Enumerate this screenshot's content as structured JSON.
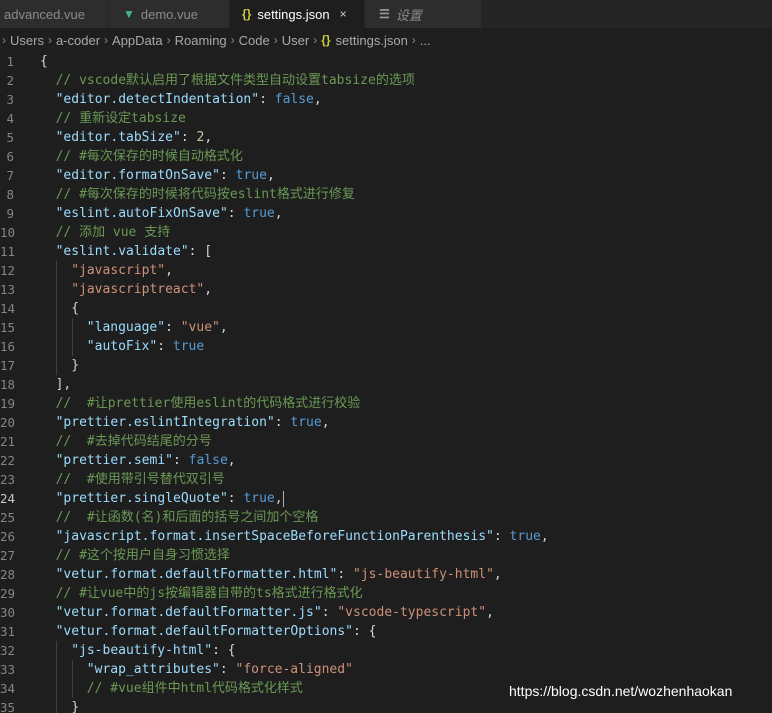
{
  "tabs": [
    {
      "label": "advanced.vue",
      "icon": "",
      "active": false
    },
    {
      "label": "demo.vue",
      "icon": "vue-icon",
      "active": false
    },
    {
      "label": "settings.json",
      "icon": "json-braces-icon",
      "active": true,
      "close": "×"
    },
    {
      "label": "设置",
      "icon": "settings-list-icon",
      "active": false
    }
  ],
  "breadcrumb": [
    "Users",
    "a-coder",
    "AppData",
    "Roaming",
    "Code",
    "User",
    "settings.json",
    "..."
  ],
  "lines": [
    {
      "n": "1",
      "i": 0,
      "t": [
        [
          "p",
          "{"
        ]
      ]
    },
    {
      "n": "2",
      "i": 1,
      "t": [
        [
          "c",
          "// vscode默认启用了根据文件类型自动设置tabsize的选项"
        ]
      ]
    },
    {
      "n": "3",
      "i": 1,
      "t": [
        [
          "k",
          "\"editor.detectIndentation\""
        ],
        [
          "p",
          ": "
        ],
        [
          "b",
          "false"
        ],
        [
          "p",
          ","
        ]
      ]
    },
    {
      "n": "4",
      "i": 1,
      "t": [
        [
          "c",
          "// 重新设定tabsize"
        ]
      ]
    },
    {
      "n": "5",
      "i": 1,
      "t": [
        [
          "k",
          "\"editor.tabSize\""
        ],
        [
          "p",
          ": "
        ],
        [
          "n",
          "2"
        ],
        [
          "p",
          ","
        ]
      ]
    },
    {
      "n": "6",
      "i": 1,
      "t": [
        [
          "c",
          "// #每次保存的时候自动格式化"
        ]
      ]
    },
    {
      "n": "7",
      "i": 1,
      "t": [
        [
          "k",
          "\"editor.formatOnSave\""
        ],
        [
          "p",
          ": "
        ],
        [
          "b",
          "true"
        ],
        [
          "p",
          ","
        ]
      ]
    },
    {
      "n": "8",
      "i": 1,
      "t": [
        [
          "c",
          "// #每次保存的时候将代码按eslint格式进行修复"
        ]
      ]
    },
    {
      "n": "9",
      "i": 1,
      "t": [
        [
          "k",
          "\"eslint.autoFixOnSave\""
        ],
        [
          "p",
          ": "
        ],
        [
          "b",
          "true"
        ],
        [
          "p",
          ","
        ]
      ]
    },
    {
      "n": "10",
      "i": 1,
      "t": [
        [
          "c",
          "// 添加 vue 支持"
        ]
      ]
    },
    {
      "n": "11",
      "i": 1,
      "t": [
        [
          "k",
          "\"eslint.validate\""
        ],
        [
          "p",
          ": ["
        ]
      ]
    },
    {
      "n": "12",
      "i": 2,
      "t": [
        [
          "s",
          "\"javascript\""
        ],
        [
          "p",
          ","
        ]
      ]
    },
    {
      "n": "13",
      "i": 2,
      "t": [
        [
          "s",
          "\"javascriptreact\""
        ],
        [
          "p",
          ","
        ]
      ]
    },
    {
      "n": "14",
      "i": 2,
      "t": [
        [
          "p",
          "{"
        ]
      ]
    },
    {
      "n": "15",
      "i": 3,
      "t": [
        [
          "k",
          "\"language\""
        ],
        [
          "p",
          ": "
        ],
        [
          "s",
          "\"vue\""
        ],
        [
          "p",
          ","
        ]
      ]
    },
    {
      "n": "16",
      "i": 3,
      "t": [
        [
          "k",
          "\"autoFix\""
        ],
        [
          "p",
          ": "
        ],
        [
          "b",
          "true"
        ]
      ]
    },
    {
      "n": "17",
      "i": 2,
      "t": [
        [
          "p",
          "}"
        ]
      ]
    },
    {
      "n": "18",
      "i": 1,
      "t": [
        [
          "p",
          "],"
        ]
      ]
    },
    {
      "n": "19",
      "i": 1,
      "t": [
        [
          "c",
          "//  #让prettier使用eslint的代码格式进行校验"
        ]
      ]
    },
    {
      "n": "20",
      "i": 1,
      "t": [
        [
          "k",
          "\"prettier.eslintIntegration\""
        ],
        [
          "p",
          ": "
        ],
        [
          "b",
          "true"
        ],
        [
          "p",
          ","
        ]
      ]
    },
    {
      "n": "21",
      "i": 1,
      "t": [
        [
          "c",
          "//  #去掉代码结尾的分号"
        ]
      ]
    },
    {
      "n": "22",
      "i": 1,
      "t": [
        [
          "k",
          "\"prettier.semi\""
        ],
        [
          "p",
          ": "
        ],
        [
          "b",
          "false"
        ],
        [
          "p",
          ","
        ]
      ]
    },
    {
      "n": "23",
      "i": 1,
      "t": [
        [
          "c",
          "//  #使用带引号替代双引号"
        ]
      ]
    },
    {
      "n": "24",
      "i": 1,
      "cur": true,
      "t": [
        [
          "k",
          "\"prettier.singleQuote\""
        ],
        [
          "p",
          ": "
        ],
        [
          "b",
          "true"
        ],
        [
          "p",
          ","
        ]
      ]
    },
    {
      "n": "25",
      "i": 1,
      "t": [
        [
          "c",
          "//  #让函数(名)和后面的括号之间加个空格"
        ]
      ]
    },
    {
      "n": "26",
      "i": 1,
      "t": [
        [
          "k",
          "\"javascript.format.insertSpaceBeforeFunctionParenthesis\""
        ],
        [
          "p",
          ": "
        ],
        [
          "b",
          "true"
        ],
        [
          "p",
          ","
        ]
      ]
    },
    {
      "n": "27",
      "i": 1,
      "t": [
        [
          "c",
          "// #这个按用户自身习惯选择"
        ]
      ]
    },
    {
      "n": "28",
      "i": 1,
      "t": [
        [
          "k",
          "\"vetur.format.defaultFormatter.html\""
        ],
        [
          "p",
          ": "
        ],
        [
          "s",
          "\"js-beautify-html\""
        ],
        [
          "p",
          ","
        ]
      ]
    },
    {
      "n": "29",
      "i": 1,
      "t": [
        [
          "c",
          "// #让vue中的js按编辑器自带的ts格式进行格式化"
        ]
      ]
    },
    {
      "n": "30",
      "i": 1,
      "t": [
        [
          "k",
          "\"vetur.format.defaultFormatter.js\""
        ],
        [
          "p",
          ": "
        ],
        [
          "s",
          "\"vscode-typescript\""
        ],
        [
          "p",
          ","
        ]
      ]
    },
    {
      "n": "31",
      "i": 1,
      "t": [
        [
          "k",
          "\"vetur.format.defaultFormatterOptions\""
        ],
        [
          "p",
          ": {"
        ]
      ]
    },
    {
      "n": "32",
      "i": 2,
      "t": [
        [
          "k",
          "\"js-beautify-html\""
        ],
        [
          "p",
          ": {"
        ]
      ]
    },
    {
      "n": "33",
      "i": 3,
      "t": [
        [
          "k",
          "\"wrap_attributes\""
        ],
        [
          "p",
          ": "
        ],
        [
          "s",
          "\"force-aligned\""
        ]
      ]
    },
    {
      "n": "34",
      "i": 3,
      "t": [
        [
          "c",
          "// #vue组件中html代码格式化样式"
        ]
      ]
    },
    {
      "n": "35",
      "i": 2,
      "t": [
        [
          "p",
          "}"
        ]
      ]
    }
  ],
  "watermark": "https://blog.csdn.net/wozhenhaokan",
  "colors": {
    "background": "#1e1e1e",
    "key": "#9cdcfe",
    "string": "#ce9178",
    "boolean": "#569cd6",
    "comment": "#6a9955",
    "number": "#b5cea8"
  }
}
